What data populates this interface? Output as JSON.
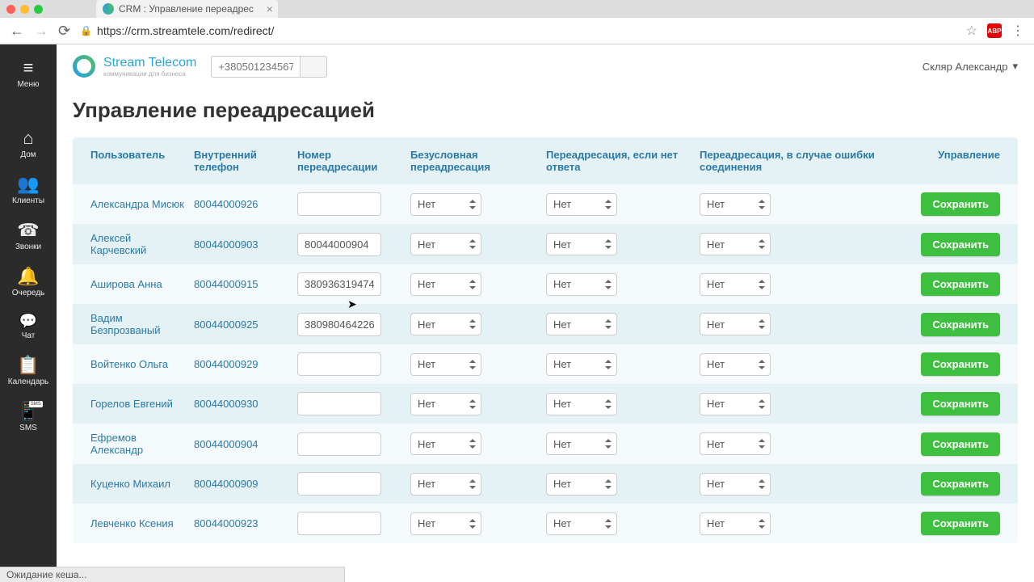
{
  "browser": {
    "tab_title": "CRM : Управление переадрес",
    "url": "https://crm.streamtele.com/redirect/",
    "status": "Ожидание кеша..."
  },
  "brand": {
    "name": "Stream Telecom",
    "sub": "коммуникации для бизнеса"
  },
  "phone_search": {
    "placeholder": "+380501234567"
  },
  "user_menu": "Скляр Александр",
  "sidebar": {
    "menu": "Меню",
    "items": [
      {
        "label": "Дом"
      },
      {
        "label": "Клиенты"
      },
      {
        "label": "Звонки"
      },
      {
        "label": "Очередь"
      },
      {
        "label": "Чат"
      },
      {
        "label": "Календарь"
      },
      {
        "label": "SMS"
      }
    ]
  },
  "page_title": "Управление переадресацией",
  "columns": {
    "user": "Пользователь",
    "ext": "Внутренний телефон",
    "num": "Номер переадресации",
    "uncond": "Безусловная переадресация",
    "noans": "Переадресация, если нет ответа",
    "err": "Переадресация, в случае ошибки соединения",
    "act": "Управление"
  },
  "select_value": "Нет",
  "save_label": "Сохранить",
  "rows": [
    {
      "user": "Александра Мисюк",
      "ext": "80044000926",
      "num": ""
    },
    {
      "user": "Алексей Карчевский",
      "ext": "80044000903",
      "num": "80044000904"
    },
    {
      "user": "Аширова Анна",
      "ext": "80044000915",
      "num": "380936319474"
    },
    {
      "user": "Вадим Безпрозваный",
      "ext": "80044000925",
      "num": "380980464226"
    },
    {
      "user": "Войтенко Ольга",
      "ext": "80044000929",
      "num": ""
    },
    {
      "user": "Горелов Евгений",
      "ext": "80044000930",
      "num": ""
    },
    {
      "user": "Ефремов Александр",
      "ext": "80044000904",
      "num": ""
    },
    {
      "user": "Куценко Михаил",
      "ext": "80044000909",
      "num": ""
    },
    {
      "user": "Левченко Ксения",
      "ext": "80044000923",
      "num": ""
    }
  ]
}
